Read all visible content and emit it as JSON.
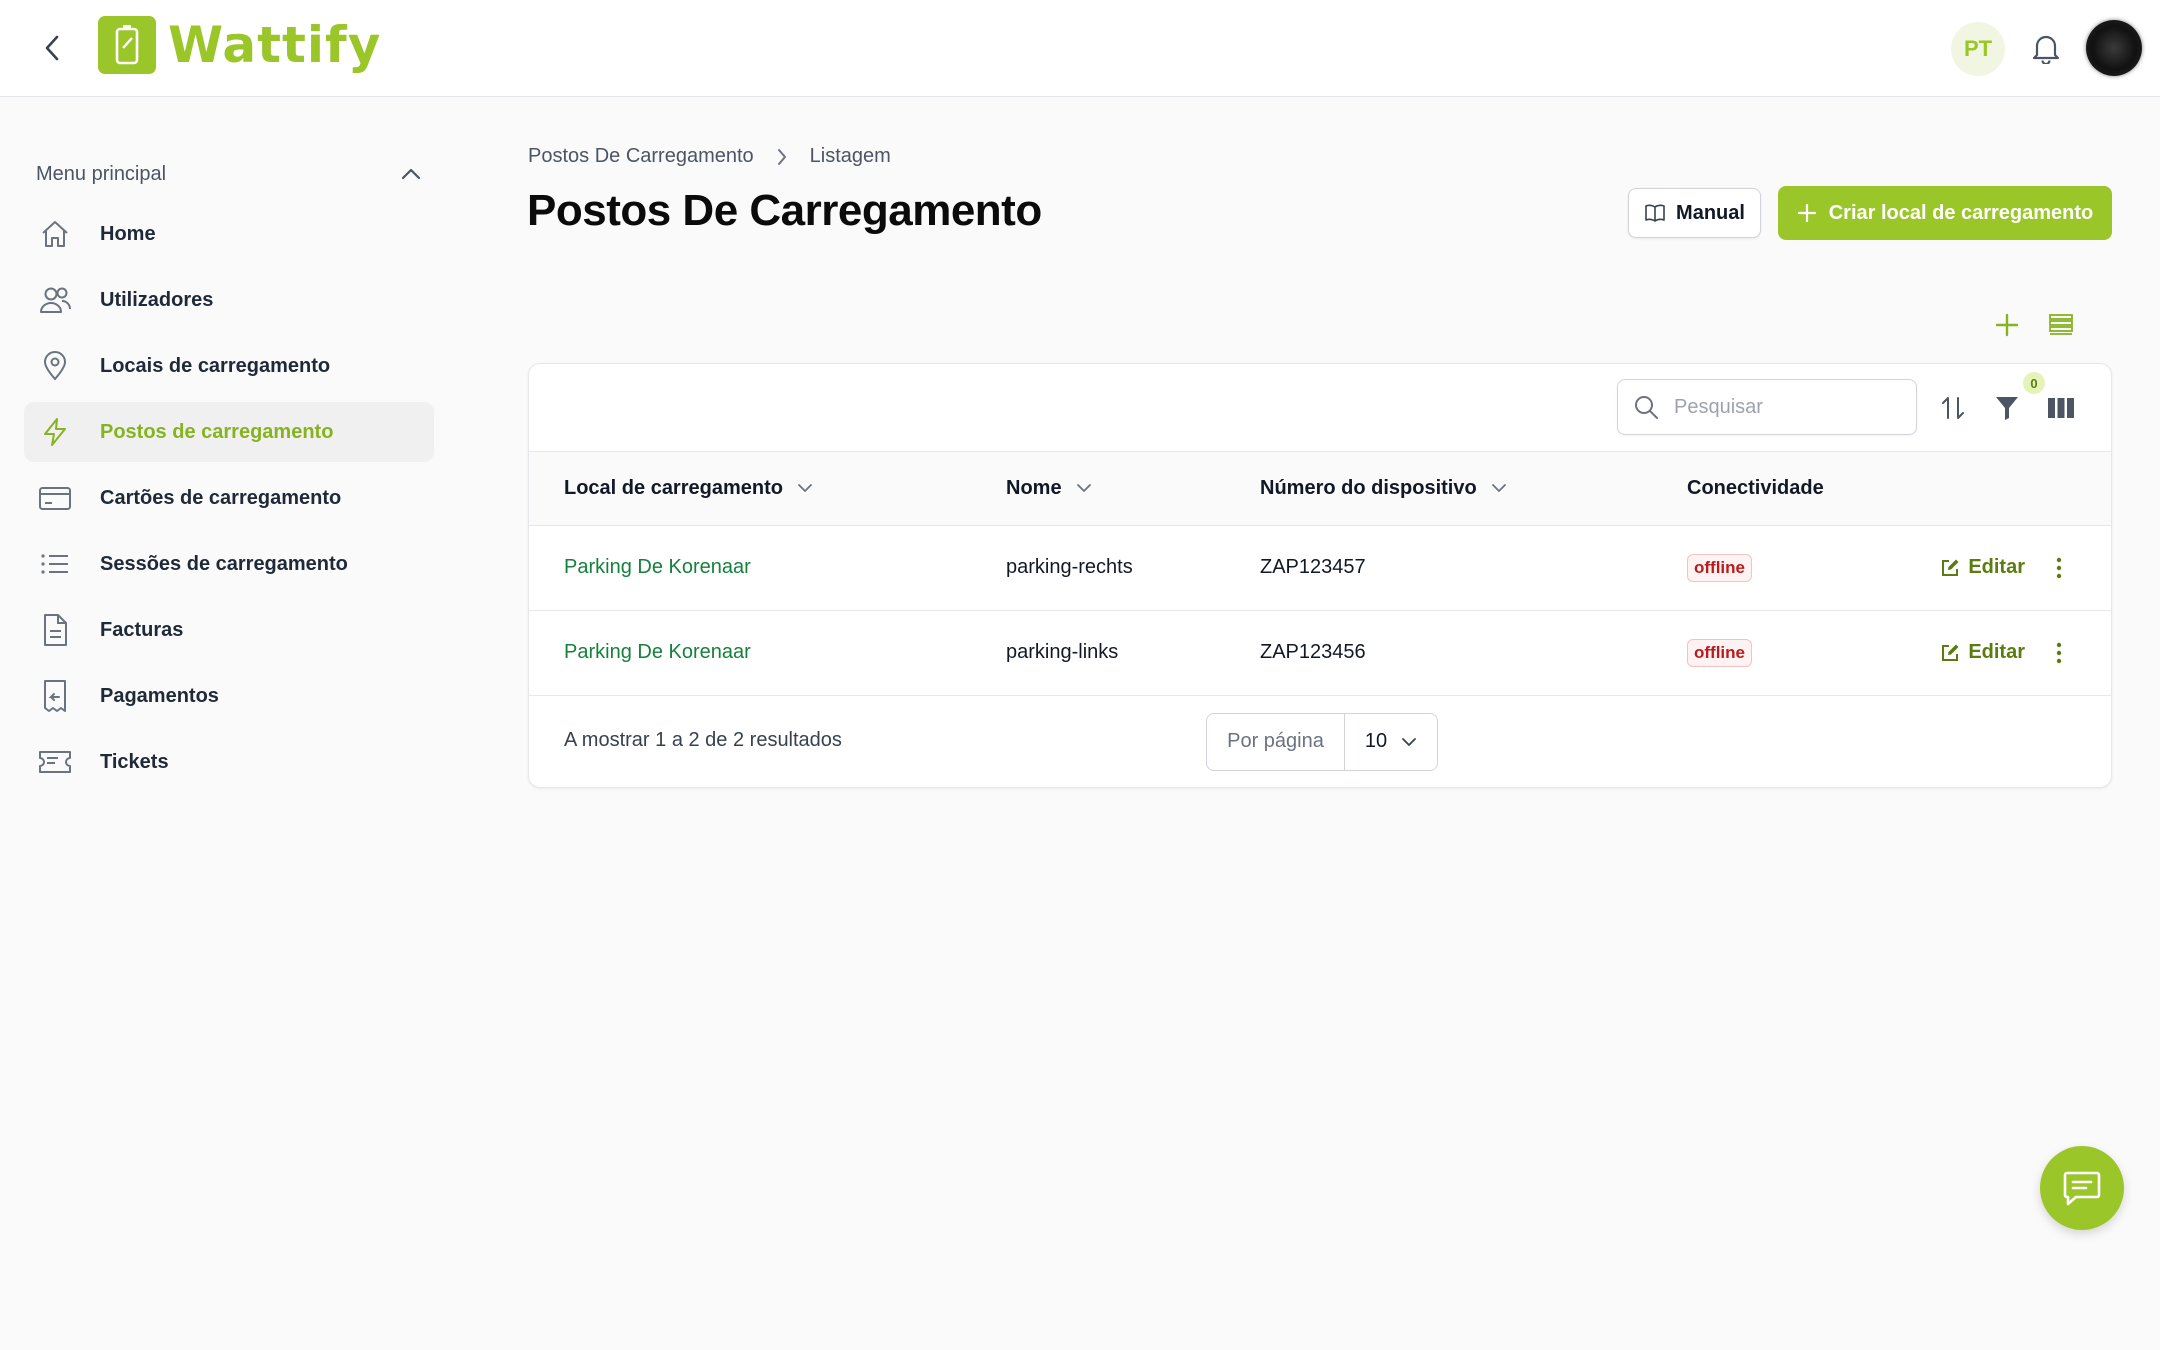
{
  "app": {
    "name": "Wattify",
    "language": "PT"
  },
  "sidebar": {
    "header": "Menu principal",
    "items": [
      {
        "label": "Home",
        "icon": "home-icon"
      },
      {
        "label": "Utilizadores",
        "icon": "users-icon"
      },
      {
        "label": "Locais de carregamento",
        "icon": "map-pin-icon"
      },
      {
        "label": "Postos de carregamento",
        "icon": "lightning-icon",
        "active": true
      },
      {
        "label": "Cartões de carregamento",
        "icon": "card-icon"
      },
      {
        "label": "Sessões de carregamento",
        "icon": "list-icon"
      },
      {
        "label": "Facturas",
        "icon": "document-icon"
      },
      {
        "label": "Pagamentos",
        "icon": "receipt-icon"
      },
      {
        "label": "Tickets",
        "icon": "ticket-icon"
      }
    ]
  },
  "breadcrumb": {
    "parent": "Postos De Carregamento",
    "current": "Listagem"
  },
  "page": {
    "title": "Postos De Carregamento"
  },
  "actions": {
    "manual": "Manual",
    "create": "Criar local de carregamento"
  },
  "toolbar": {
    "search_placeholder": "Pesquisar",
    "filter_count": "0"
  },
  "table": {
    "columns": [
      "Local de carregamento",
      "Nome",
      "Número do dispositivo",
      "Conectividade"
    ],
    "edit_label": "Editar",
    "rows": [
      {
        "location": "Parking De Korenaar",
        "name": "parking-rechts",
        "device": "ZAP123457",
        "status": "offline"
      },
      {
        "location": "Parking De Korenaar",
        "name": "parking-links",
        "device": "ZAP123456",
        "status": "offline"
      }
    ]
  },
  "footer": {
    "results": "A mostrar 1 a 2 de 2 resultados",
    "per_page_label": "Por página",
    "per_page_value": "10"
  },
  "colors": {
    "brand": "#9bc62a",
    "link": "#16803c",
    "offline": "#b91c1c"
  }
}
